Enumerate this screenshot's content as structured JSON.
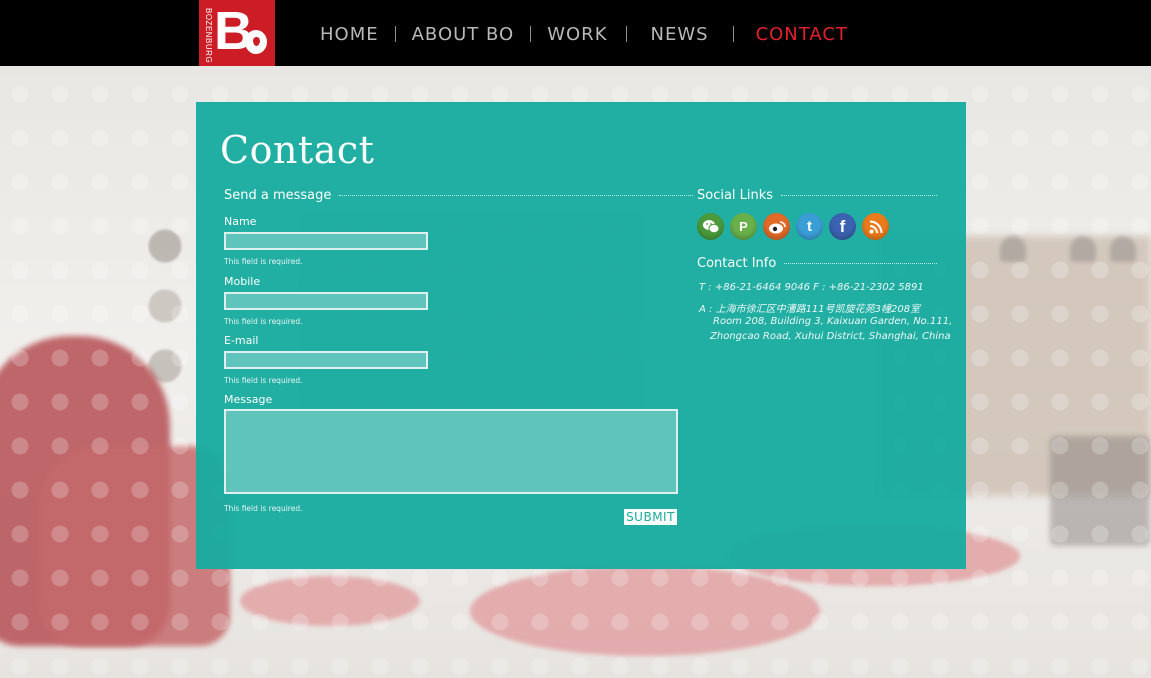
{
  "logo": {
    "vertical_text": "BOZENBURG",
    "mark": "B"
  },
  "nav": [
    {
      "label": "HOME",
      "active": false
    },
    {
      "label": "ABOUT BO",
      "active": false
    },
    {
      "label": "WORK",
      "active": false
    },
    {
      "label": "NEWS",
      "active": false
    },
    {
      "label": "CONTACT",
      "active": true
    }
  ],
  "panel": {
    "title": "Contact",
    "form": {
      "heading": "Send a message",
      "name_label": "Name",
      "name_value": "",
      "name_error": "This field is required.",
      "mobile_label": "Mobile",
      "mobile_value": "",
      "mobile_error": "This field is required.",
      "email_label": "E-mail",
      "email_value": "",
      "email_error": "This field is required.",
      "message_label": "Message",
      "message_value": "",
      "message_error": "This field is required.",
      "submit_label": "SUBMIT"
    },
    "social": {
      "heading": "Social Links",
      "icons": [
        "wechat-icon",
        "pengyou-icon",
        "weibo-icon",
        "twitter-icon",
        "facebook-icon",
        "rss-icon"
      ]
    },
    "contact_info": {
      "heading": "Contact Info",
      "phone": "T : +86-21-6464 9046    F : +86-21-2302 5891",
      "address_cn": "A : 上海市徐汇区中漕路111号凯旋花苑3幢208室",
      "address_en_1": "Room 208, Building 3, Kaixuan Garden, No.111,",
      "address_en_2": "Zhongcao Road, Xuhui District, Shanghai, China"
    }
  },
  "colors": {
    "panel": "#1aaba0",
    "header": "#000000",
    "brand_red": "#cc1d26",
    "nav_active": "#e0222b"
  }
}
